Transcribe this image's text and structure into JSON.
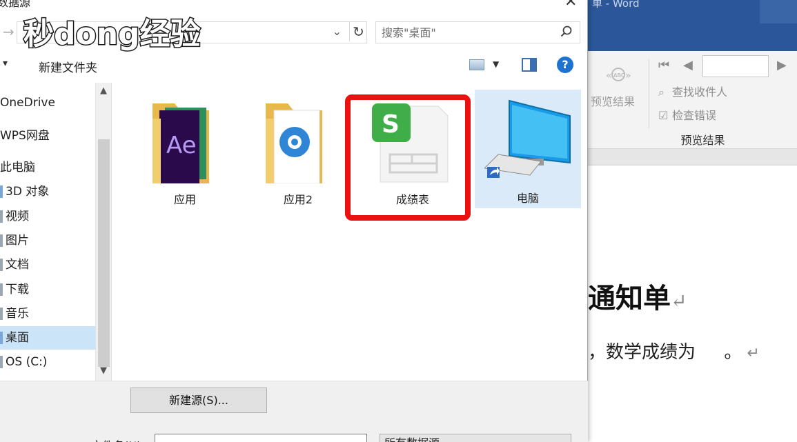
{
  "dialog": {
    "title_fragment": "数据源",
    "close_glyph": "✕",
    "address": {
      "dropdown_glyph": "⌄",
      "refresh_glyph": "↻"
    },
    "search": {
      "placeholder": "搜索\"桌面\"",
      "icon": "search-icon"
    },
    "command_bar": {
      "new_folder": "新建文件夹",
      "help_glyph": "?"
    },
    "nav_items": [
      {
        "label": "OneDrive",
        "selected": false
      },
      {
        "label": "WPS网盘",
        "selected": false
      },
      {
        "label": "此电脑",
        "selected": false
      },
      {
        "label": "3D 对象",
        "selected": false
      },
      {
        "label": "视频",
        "selected": false
      },
      {
        "label": "图片",
        "selected": false
      },
      {
        "label": "文档",
        "selected": false
      },
      {
        "label": "下载",
        "selected": false
      },
      {
        "label": "音乐",
        "selected": false
      },
      {
        "label": "桌面",
        "selected": true
      },
      {
        "label": "OS (C:)",
        "selected": false
      }
    ],
    "files": [
      {
        "label": "应用",
        "icon": "folder-ae-icon"
      },
      {
        "label": "应用2",
        "icon": "folder-settings-icon"
      },
      {
        "label": "成绩表",
        "icon": "wps-spreadsheet-icon",
        "highlighted": true
      },
      {
        "label": "电脑",
        "icon": "computer-shortcut-icon",
        "selected": true
      }
    ],
    "new_source_button": "新建源(S)...",
    "filename_label": "文件名(N):",
    "filename_value": "",
    "filter_value": "所有数据源"
  },
  "word": {
    "title_fragment": "单 - Word",
    "ribbon": {
      "preview_results": "预览结果",
      "find_recipient": "查找收件人",
      "check_errors": "检查错误",
      "group_label": "预览结果",
      "record_value": ""
    },
    "document": {
      "heading": "通知单",
      "line": "，数学成绩为     。"
    }
  },
  "watermark": {
    "text": "秒懂经验"
  },
  "colors": {
    "accent": "#2b579a",
    "highlight": "#ec1111",
    "selection": "#cce4f7"
  }
}
